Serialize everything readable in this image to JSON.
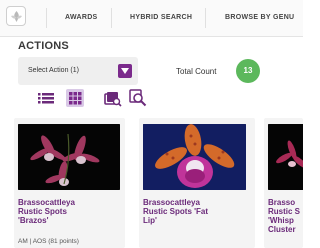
{
  "nav": {
    "awards": "AWARDS",
    "hybrid_search": "HYBRID SEARCH",
    "browse_by_genus": "BROWSE BY GENU"
  },
  "actions": {
    "title": "ACTIONS",
    "select_label": "Select Action (1)",
    "total_count_label": "Total Count",
    "total_count": "13"
  },
  "icons": [
    "list-view-icon",
    "grid-view-icon",
    "image-search-icon",
    "zoom-search-icon"
  ],
  "colors": {
    "accent_purple": "#7b2a8c",
    "count_green": "#5cb85c",
    "title_purple": "#6b2a7a"
  },
  "cards": [
    {
      "line1": "Brassocattleya",
      "line2": "Rustic Spots",
      "line3": "'Brazos'",
      "sub": "AM | AOS (81 points)"
    },
    {
      "line1": "Brassocattleya",
      "line2": "Rustic Spots 'Fat",
      "line3": "Lip'",
      "sub": ""
    },
    {
      "line1": "Brasso",
      "line2": "Rustic S",
      "line3": "'Whisp",
      "line4": "Cluster",
      "sub": ""
    }
  ]
}
